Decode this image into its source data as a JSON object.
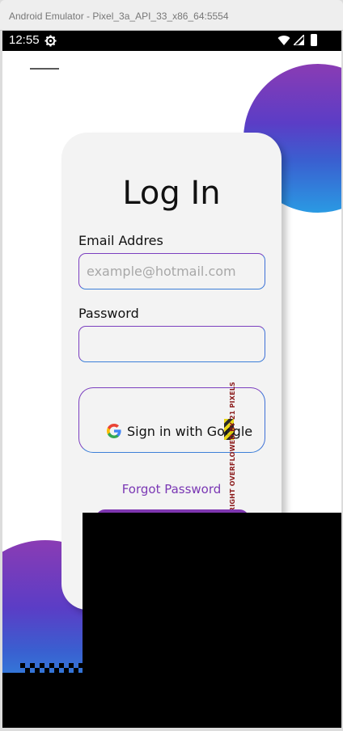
{
  "window": {
    "title": "Android Emulator - Pixel_3a_API_33_x86_64:5554"
  },
  "statusbar": {
    "time": "12:55",
    "icons": [
      "gear-icon",
      "wifi-icon",
      "signal-icon",
      "battery-icon"
    ]
  },
  "login": {
    "title": "Log In",
    "email_label": "Email  Addres",
    "email_placeholder": "example@hotmail.com",
    "email_value": "",
    "password_label": "Password",
    "password_value": "",
    "google_button_label": "Sign in with Google",
    "overflow_warning": "RIGHT OVERFLOWED BY 21 PIXELS",
    "forgot_password": "Forgot Password"
  },
  "colors": {
    "accent": "#7a37b4",
    "blob_gradient_top": "#8a3cb4",
    "blob_gradient_bottom": "#2a9ae3",
    "card_background": "#f3f3f3"
  }
}
